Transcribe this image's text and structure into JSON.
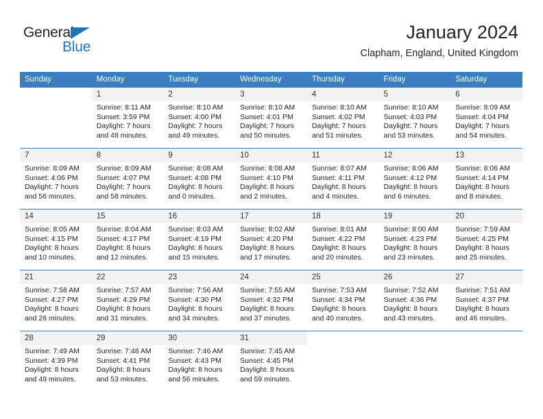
{
  "brand": {
    "name_part1": "General",
    "name_part2": "Blue",
    "accent_color": "#1b75bb"
  },
  "header": {
    "month_title": "January 2024",
    "location": "Clapham, England, United Kingdom"
  },
  "calendar": {
    "header_background": "#3b7ec0",
    "weekday_headers": [
      "Sunday",
      "Monday",
      "Tuesday",
      "Wednesday",
      "Thursday",
      "Friday",
      "Saturday"
    ],
    "weeks": [
      [
        {
          "day": "",
          "sunrise": "",
          "sunset": "",
          "daylight_line1": "",
          "daylight_line2": "",
          "empty": true
        },
        {
          "day": "1",
          "sunrise": "Sunrise: 8:11 AM",
          "sunset": "Sunset: 3:59 PM",
          "daylight_line1": "Daylight: 7 hours",
          "daylight_line2": "and 48 minutes.",
          "empty": false
        },
        {
          "day": "2",
          "sunrise": "Sunrise: 8:10 AM",
          "sunset": "Sunset: 4:00 PM",
          "daylight_line1": "Daylight: 7 hours",
          "daylight_line2": "and 49 minutes.",
          "empty": false
        },
        {
          "day": "3",
          "sunrise": "Sunrise: 8:10 AM",
          "sunset": "Sunset: 4:01 PM",
          "daylight_line1": "Daylight: 7 hours",
          "daylight_line2": "and 50 minutes.",
          "empty": false
        },
        {
          "day": "4",
          "sunrise": "Sunrise: 8:10 AM",
          "sunset": "Sunset: 4:02 PM",
          "daylight_line1": "Daylight: 7 hours",
          "daylight_line2": "and 51 minutes.",
          "empty": false
        },
        {
          "day": "5",
          "sunrise": "Sunrise: 8:10 AM",
          "sunset": "Sunset: 4:03 PM",
          "daylight_line1": "Daylight: 7 hours",
          "daylight_line2": "and 53 minutes.",
          "empty": false
        },
        {
          "day": "6",
          "sunrise": "Sunrise: 8:09 AM",
          "sunset": "Sunset: 4:04 PM",
          "daylight_line1": "Daylight: 7 hours",
          "daylight_line2": "and 54 minutes.",
          "empty": false
        }
      ],
      [
        {
          "day": "7",
          "sunrise": "Sunrise: 8:09 AM",
          "sunset": "Sunset: 4:06 PM",
          "daylight_line1": "Daylight: 7 hours",
          "daylight_line2": "and 56 minutes.",
          "empty": false
        },
        {
          "day": "8",
          "sunrise": "Sunrise: 8:09 AM",
          "sunset": "Sunset: 4:07 PM",
          "daylight_line1": "Daylight: 7 hours",
          "daylight_line2": "and 58 minutes.",
          "empty": false
        },
        {
          "day": "9",
          "sunrise": "Sunrise: 8:08 AM",
          "sunset": "Sunset: 4:08 PM",
          "daylight_line1": "Daylight: 8 hours",
          "daylight_line2": "and 0 minutes.",
          "empty": false
        },
        {
          "day": "10",
          "sunrise": "Sunrise: 8:08 AM",
          "sunset": "Sunset: 4:10 PM",
          "daylight_line1": "Daylight: 8 hours",
          "daylight_line2": "and 2 minutes.",
          "empty": false
        },
        {
          "day": "11",
          "sunrise": "Sunrise: 8:07 AM",
          "sunset": "Sunset: 4:11 PM",
          "daylight_line1": "Daylight: 8 hours",
          "daylight_line2": "and 4 minutes.",
          "empty": false
        },
        {
          "day": "12",
          "sunrise": "Sunrise: 8:06 AM",
          "sunset": "Sunset: 4:12 PM",
          "daylight_line1": "Daylight: 8 hours",
          "daylight_line2": "and 6 minutes.",
          "empty": false
        },
        {
          "day": "13",
          "sunrise": "Sunrise: 8:06 AM",
          "sunset": "Sunset: 4:14 PM",
          "daylight_line1": "Daylight: 8 hours",
          "daylight_line2": "and 8 minutes.",
          "empty": false
        }
      ],
      [
        {
          "day": "14",
          "sunrise": "Sunrise: 8:05 AM",
          "sunset": "Sunset: 4:15 PM",
          "daylight_line1": "Daylight: 8 hours",
          "daylight_line2": "and 10 minutes.",
          "empty": false
        },
        {
          "day": "15",
          "sunrise": "Sunrise: 8:04 AM",
          "sunset": "Sunset: 4:17 PM",
          "daylight_line1": "Daylight: 8 hours",
          "daylight_line2": "and 12 minutes.",
          "empty": false
        },
        {
          "day": "16",
          "sunrise": "Sunrise: 8:03 AM",
          "sunset": "Sunset: 4:19 PM",
          "daylight_line1": "Daylight: 8 hours",
          "daylight_line2": "and 15 minutes.",
          "empty": false
        },
        {
          "day": "17",
          "sunrise": "Sunrise: 8:02 AM",
          "sunset": "Sunset: 4:20 PM",
          "daylight_line1": "Daylight: 8 hours",
          "daylight_line2": "and 17 minutes.",
          "empty": false
        },
        {
          "day": "18",
          "sunrise": "Sunrise: 8:01 AM",
          "sunset": "Sunset: 4:22 PM",
          "daylight_line1": "Daylight: 8 hours",
          "daylight_line2": "and 20 minutes.",
          "empty": false
        },
        {
          "day": "19",
          "sunrise": "Sunrise: 8:00 AM",
          "sunset": "Sunset: 4:23 PM",
          "daylight_line1": "Daylight: 8 hours",
          "daylight_line2": "and 23 minutes.",
          "empty": false
        },
        {
          "day": "20",
          "sunrise": "Sunrise: 7:59 AM",
          "sunset": "Sunset: 4:25 PM",
          "daylight_line1": "Daylight: 8 hours",
          "daylight_line2": "and 25 minutes.",
          "empty": false
        }
      ],
      [
        {
          "day": "21",
          "sunrise": "Sunrise: 7:58 AM",
          "sunset": "Sunset: 4:27 PM",
          "daylight_line1": "Daylight: 8 hours",
          "daylight_line2": "and 28 minutes.",
          "empty": false
        },
        {
          "day": "22",
          "sunrise": "Sunrise: 7:57 AM",
          "sunset": "Sunset: 4:29 PM",
          "daylight_line1": "Daylight: 8 hours",
          "daylight_line2": "and 31 minutes.",
          "empty": false
        },
        {
          "day": "23",
          "sunrise": "Sunrise: 7:56 AM",
          "sunset": "Sunset: 4:30 PM",
          "daylight_line1": "Daylight: 8 hours",
          "daylight_line2": "and 34 minutes.",
          "empty": false
        },
        {
          "day": "24",
          "sunrise": "Sunrise: 7:55 AM",
          "sunset": "Sunset: 4:32 PM",
          "daylight_line1": "Daylight: 8 hours",
          "daylight_line2": "and 37 minutes.",
          "empty": false
        },
        {
          "day": "25",
          "sunrise": "Sunrise: 7:53 AM",
          "sunset": "Sunset: 4:34 PM",
          "daylight_line1": "Daylight: 8 hours",
          "daylight_line2": "and 40 minutes.",
          "empty": false
        },
        {
          "day": "26",
          "sunrise": "Sunrise: 7:52 AM",
          "sunset": "Sunset: 4:36 PM",
          "daylight_line1": "Daylight: 8 hours",
          "daylight_line2": "and 43 minutes.",
          "empty": false
        },
        {
          "day": "27",
          "sunrise": "Sunrise: 7:51 AM",
          "sunset": "Sunset: 4:37 PM",
          "daylight_line1": "Daylight: 8 hours",
          "daylight_line2": "and 46 minutes.",
          "empty": false
        }
      ],
      [
        {
          "day": "28",
          "sunrise": "Sunrise: 7:49 AM",
          "sunset": "Sunset: 4:39 PM",
          "daylight_line1": "Daylight: 8 hours",
          "daylight_line2": "and 49 minutes.",
          "empty": false
        },
        {
          "day": "29",
          "sunrise": "Sunrise: 7:48 AM",
          "sunset": "Sunset: 4:41 PM",
          "daylight_line1": "Daylight: 8 hours",
          "daylight_line2": "and 53 minutes.",
          "empty": false
        },
        {
          "day": "30",
          "sunrise": "Sunrise: 7:46 AM",
          "sunset": "Sunset: 4:43 PM",
          "daylight_line1": "Daylight: 8 hours",
          "daylight_line2": "and 56 minutes.",
          "empty": false
        },
        {
          "day": "31",
          "sunrise": "Sunrise: 7:45 AM",
          "sunset": "Sunset: 4:45 PM",
          "daylight_line1": "Daylight: 8 hours",
          "daylight_line2": "and 59 minutes.",
          "empty": false
        },
        {
          "day": "",
          "sunrise": "",
          "sunset": "",
          "daylight_line1": "",
          "daylight_line2": "",
          "empty": true
        },
        {
          "day": "",
          "sunrise": "",
          "sunset": "",
          "daylight_line1": "",
          "daylight_line2": "",
          "empty": true
        },
        {
          "day": "",
          "sunrise": "",
          "sunset": "",
          "daylight_line1": "",
          "daylight_line2": "",
          "empty": true
        }
      ]
    ]
  }
}
